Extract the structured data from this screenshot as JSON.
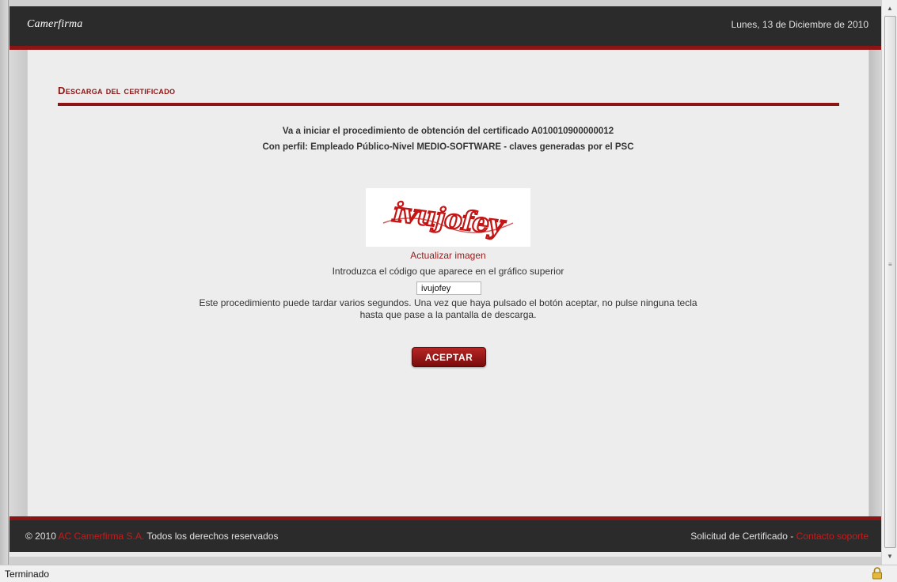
{
  "header": {
    "logo": "Camerfirma",
    "date": "Lunes, 13 de Diciembre de 2010"
  },
  "main": {
    "section_title": "Descarga del certificado",
    "line1": "Va a iniciar el procedimiento de obtención del certificado A010010900000012",
    "line2": "Con perfil: Empleado Público-Nivel MEDIO-SOFTWARE - claves generadas por el PSC",
    "captcha_text": "ivujofey",
    "refresh_link": "Actualizar imagen",
    "instruction": "Introduzca el código que aparece en el gráfico superior",
    "code_value": "ivujofey",
    "note_line1": "Este procedimiento puede tardar varios segundos. Una vez que haya pulsado el botón aceptar, no pulse ninguna tecla",
    "note_line2": "hasta que pase a la pantalla de descarga.",
    "accept_label": "ACEPTAR"
  },
  "footer": {
    "copyright_prefix": "© 2010",
    "company_link": "AC Camerfirma S.A.",
    "rights": "Todos los derechos reservados",
    "right_text": "Solicitud de Certificado -",
    "support_link": "Contacto soporte"
  },
  "statusbar": {
    "text": "Terminado"
  },
  "colors": {
    "brand_red": "#8b1414",
    "dark_bar": "#2b2b2b",
    "link_red": "#c41c1c"
  }
}
